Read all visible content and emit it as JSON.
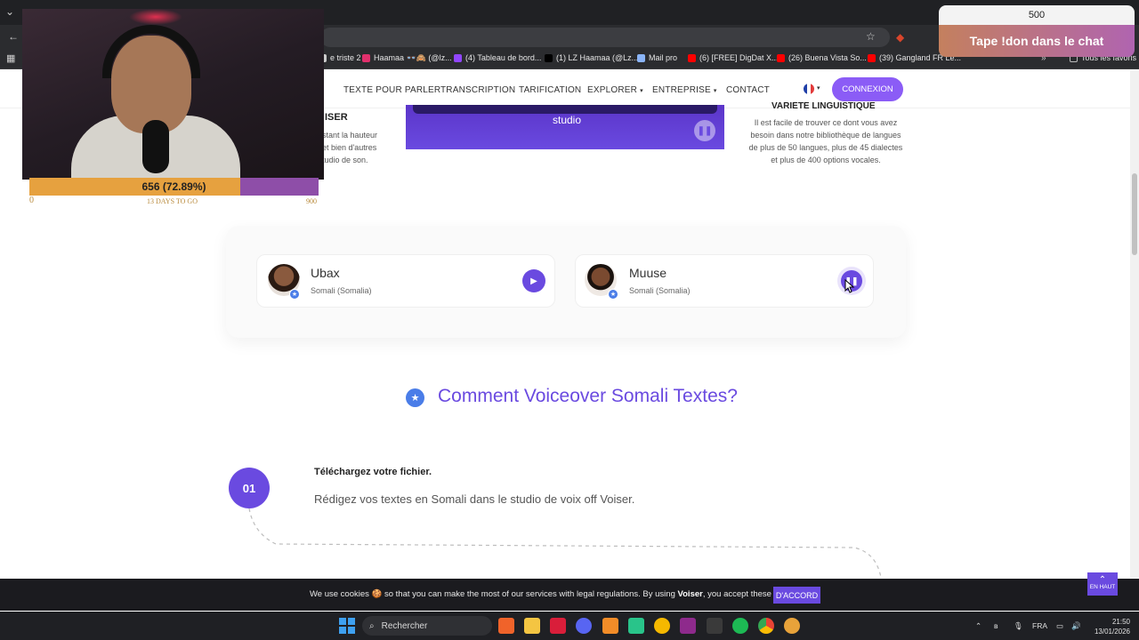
{
  "browser": {
    "bookmarks": [
      {
        "label": "e triste 2",
        "color": "#cccccc"
      },
      {
        "label": "Haamaa 👓🙈 (@lz...",
        "color": "#e1306c"
      },
      {
        "label": "(4) Tableau de bord...",
        "color": "#9146ff"
      },
      {
        "label": "(1) LZ Haamaa (@Lz...",
        "color": "#000000"
      },
      {
        "label": "Mail pro",
        "color": "#8ab4f8"
      },
      {
        "label": "(6) [FREE] DigDat X...",
        "color": "#ff0000"
      },
      {
        "label": "(26) Buena Vista So...",
        "color": "#ff0000"
      },
      {
        "label": "(39) Gangland FR Le...",
        "color": "#ff0000"
      }
    ],
    "all_bookmarks": "Tous les favoris"
  },
  "nav": {
    "items": [
      "TEXTE POUR PARLER",
      "TRANSCRIPTION",
      "TARIFICATION",
      "EXPLORER",
      "ENTREPRISE",
      "CONTACT"
    ],
    "connexion": "CONNEXION"
  },
  "features": {
    "left_title": "ISER",
    "left_lines": [
      "stant la hauteur",
      "et bien d'autres",
      "tudio de son."
    ],
    "video_label": "studio",
    "right_title": "VARIÉTÉ LINGUISTIQUE",
    "right_lines": [
      "Il est facile de trouver ce dont vous avez",
      "besoin dans notre bibliothèque de langues",
      "de plus de 50 langues, plus de 45 dialectes",
      "et plus de 400 options vocales."
    ]
  },
  "progress": {
    "label": "656 (72.89%)",
    "fraction": 0.7289,
    "min": "0",
    "days": "13 DAYS TO GO",
    "max": "900"
  },
  "donation": {
    "count": "500",
    "cta": "Tape !don dans le chat"
  },
  "voices": [
    {
      "name": "Ubax",
      "language": "Somali (Somalia)",
      "state": "play"
    },
    {
      "name": "Muuse",
      "language": "Somali (Somalia)",
      "state": "pause"
    }
  ],
  "section": {
    "title": "Comment Voiceover Somali Textes?",
    "step_number": "01",
    "step_title": "Téléchargez votre fichier.",
    "step_text": "Rédigez vos textes en Somali dans le studio de voix off Voiser."
  },
  "cookie": {
    "before": "We use cookies 🍪 so that you can make the most of our services with legal regulations. By using ",
    "brand": "Voiser",
    "after": ", you accept these cookies.",
    "button": "D'ACCORD"
  },
  "back_to_top": {
    "arrow": "⌃",
    "label": "EN HAUT"
  },
  "taskbar": {
    "search": "Rechercher",
    "lang": "FRA",
    "time": "21:50",
    "date": "13/01/2026"
  },
  "colors": {
    "accent": "#6a4ae0",
    "connexion": "#8b5cf6",
    "badge": "#4a7de8",
    "progress_fill": "#e6a13f",
    "progress_track": "#8e4ea8"
  }
}
